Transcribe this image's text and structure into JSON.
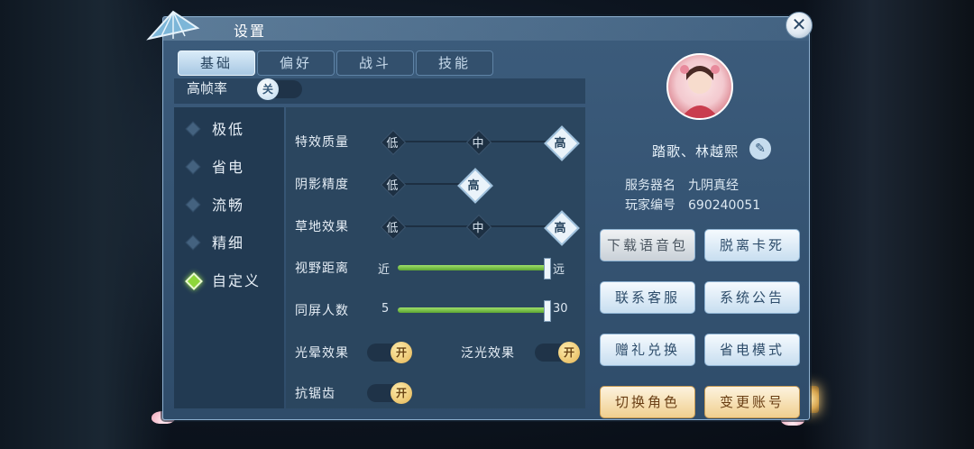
{
  "window": {
    "title": "设置",
    "close_label": "✕"
  },
  "tabs": [
    {
      "label": "基础",
      "active": true
    },
    {
      "label": "偏好",
      "active": false
    },
    {
      "label": "战斗",
      "active": false
    },
    {
      "label": "技能",
      "active": false
    }
  ],
  "high_fps": {
    "label": "高帧率",
    "state": "关"
  },
  "quality_presets": [
    {
      "label": "极低",
      "selected": false
    },
    {
      "label": "省电",
      "selected": false
    },
    {
      "label": "流畅",
      "selected": false
    },
    {
      "label": "精细",
      "selected": false
    },
    {
      "label": "自定义",
      "selected": true
    }
  ],
  "settings": {
    "effect_quality": {
      "label": "特效质量",
      "options": [
        "低",
        "中",
        "高"
      ],
      "selected": "高"
    },
    "shadow_precision": {
      "label": "阴影精度",
      "options": [
        "低",
        "高"
      ],
      "selected": "高"
    },
    "grass_effect": {
      "label": "草地效果",
      "options": [
        "低",
        "中",
        "高"
      ],
      "selected": "高"
    },
    "view_distance": {
      "label": "视野距离",
      "min_label": "近",
      "max_label": "远",
      "value_fraction": 1.0
    },
    "same_screen_players": {
      "label": "同屏人数",
      "min_label": "5",
      "max_label": "30",
      "value": 30
    },
    "bloom": {
      "label": "光晕效果",
      "state": "开"
    },
    "glow": {
      "label": "泛光效果",
      "state": "开"
    },
    "antialias": {
      "label": "抗锯齿",
      "state": "开"
    }
  },
  "player": {
    "name": "踏歌、林越熙",
    "server_key": "服务器名",
    "server_value": "九阴真经",
    "id_key": "玩家编号",
    "id_value": "690240051"
  },
  "buttons": {
    "download_voice": "下载语音包",
    "unstuck": "脱离卡死",
    "contact_support": "联系客服",
    "announcement": "系统公告",
    "gift_redeem": "赠礼兑换",
    "power_save": "省电模式",
    "switch_role": "切换角色",
    "change_account": "变更账号"
  }
}
